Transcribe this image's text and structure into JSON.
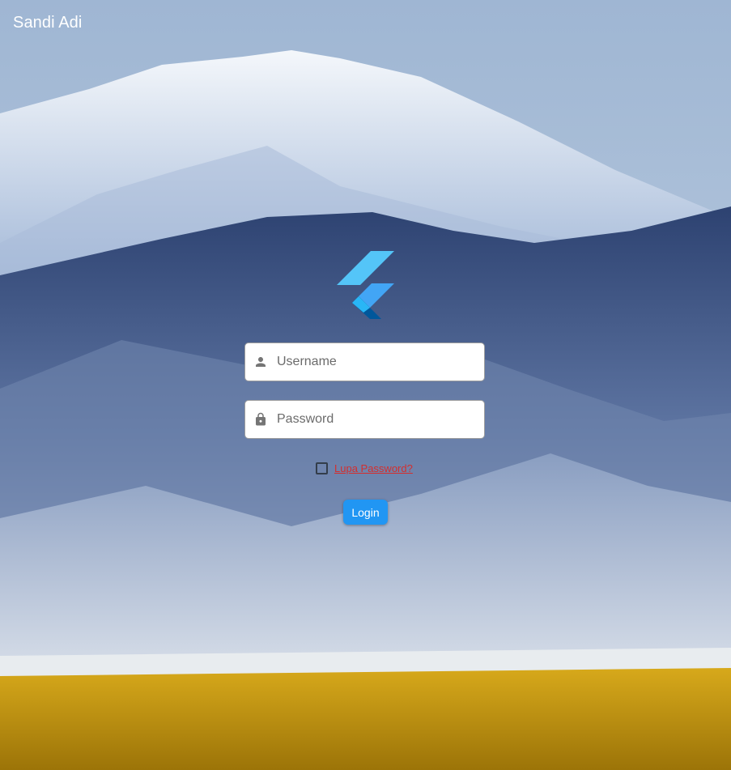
{
  "appbar": {
    "title": "Sandi Adi"
  },
  "form": {
    "username": {
      "placeholder": "Username",
      "value": "",
      "icon": "person-icon"
    },
    "password": {
      "placeholder": "Password",
      "value": "",
      "icon": "lock-icon"
    },
    "remember": {
      "checked": false,
      "link_label": "Lupa Password?"
    },
    "login_label": "Login"
  },
  "logo": {
    "icon": "flutter-logo-icon"
  },
  "background": {
    "scene": "mountain-landscape"
  },
  "colors": {
    "accent": "#2196f3",
    "link": "#d32f2f",
    "logo_light": "#42a5f5",
    "logo_dark": "#0d47a1"
  }
}
